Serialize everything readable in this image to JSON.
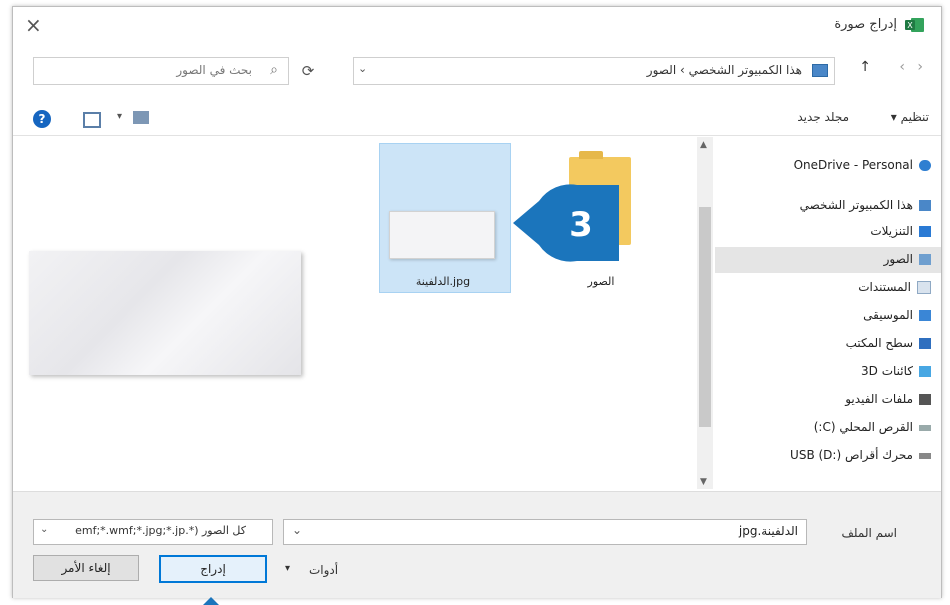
{
  "window": {
    "title": "إدراج صورة",
    "close_symbol": "×"
  },
  "address_bar": {
    "path": "هذا الكمبيوتر الشخصي › الصور",
    "refresh_symbol": "⟳",
    "dropdown_symbol": "⌄"
  },
  "search": {
    "placeholder": "بحث في الصور"
  },
  "toolbar": {
    "organize_label": "تنظيم ▾",
    "new_folder_label": "مجلد جديد",
    "help_symbol": "?"
  },
  "files": [
    {
      "label": "jpg.الدلفينة",
      "selected": true
    },
    {
      "label": "الصور",
      "selected": false
    }
  ],
  "callout": {
    "number": "3",
    "color": "#1b75bc"
  },
  "nav_pane": {
    "items": [
      {
        "label": "OneDrive - Personal",
        "icon": "cloud-icon"
      },
      {
        "label": "هذا الكمبيوتر الشخصي",
        "icon": "computer-icon"
      },
      {
        "label": "التنزيلات",
        "icon": "download-icon"
      },
      {
        "label": "الصور",
        "icon": "pictures-icon",
        "selected": true
      },
      {
        "label": "المستندات",
        "icon": "documents-icon"
      },
      {
        "label": "الموسيقى",
        "icon": "music-icon"
      },
      {
        "label": "سطح المكتب",
        "icon": "desktop-icon"
      },
      {
        "label": "كائنات 3D",
        "icon": "3d-objects-icon"
      },
      {
        "label": "ملفات الفيديو",
        "icon": "video-icon"
      },
      {
        "label": "القرص المحلي (C:)",
        "icon": "drive-icon"
      },
      {
        "label": "محرك أقراص USB (D:)",
        "icon": "usb-drive-icon"
      }
    ]
  },
  "bottom": {
    "filename_label": "اسم الملف",
    "filename_value": "jpg.الدلفينة",
    "filetype_value": "كل الصور (*.emf;*.wmf;*.jpg;*.jp",
    "tools_label": "أدوات",
    "insert_label": "إدراج",
    "cancel_label": "إلغاء الأمر"
  }
}
